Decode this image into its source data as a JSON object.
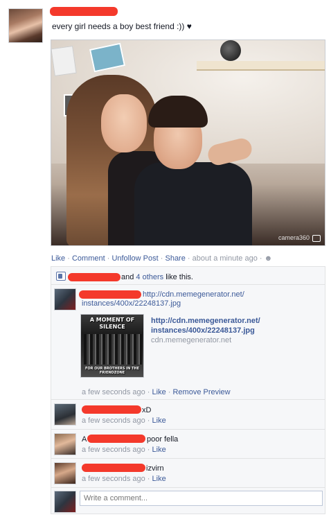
{
  "post": {
    "text": "every girl needs a boy best friend :)) ♥",
    "photo_watermark": "camera360"
  },
  "actions": {
    "like": "Like",
    "comment": "Comment",
    "unfollow": "Unfollow Post",
    "share": "Share",
    "time": "about a minute ago",
    "sep": " · "
  },
  "likes": {
    "text_mid": "and",
    "others": "4 others",
    "text_end": "like this."
  },
  "comments": [
    {
      "link_part1": "http://cdn.memegenerator.net/",
      "link_part2": "instances/400x/22248137.jpg",
      "preview_title_1": "http://cdn.memegenerator.net/",
      "preview_title_2": "instances/400x/22248137.jpg",
      "preview_domain": "cdn.memegenerator.net",
      "meme_top": "A MOMENT OF SILENCE",
      "meme_bottom": "FOR OUR BROTHERS IN THE FRIENDZONE",
      "time": "a few seconds ago",
      "like": "Like",
      "remove": "Remove Preview"
    },
    {
      "text": "xD",
      "time": "a few seconds ago",
      "like": "Like"
    },
    {
      "prefix": "A",
      "text": "poor fella",
      "time": "a few seconds ago",
      "like": "Like"
    },
    {
      "text": "izvirn",
      "time": "a few seconds ago",
      "like": "Like"
    }
  ],
  "composer": {
    "placeholder": "Write a comment..."
  },
  "colors": {
    "link": "#3b5998",
    "redaction": "#f4392b",
    "meta": "#9197a3"
  }
}
